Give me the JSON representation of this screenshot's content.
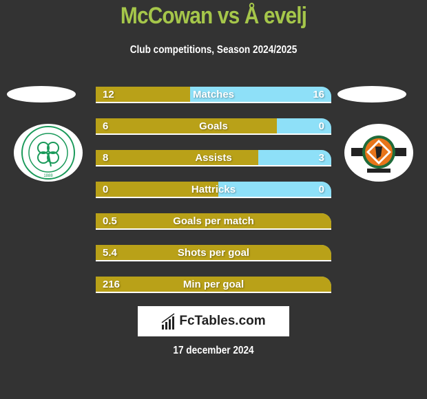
{
  "header": {
    "title": "McCowan vs Å evelj",
    "subtitle": "Club competitions, Season 2024/2025"
  },
  "teams": {
    "left": {
      "crest_icon": "celtic-fc-crest-icon",
      "crest_text": "THE CELTIC FOOTBALL CLUB 1888"
    },
    "right": {
      "crest_icon": "dundee-united-crest-icon"
    }
  },
  "colors": {
    "left_bar": "#b9a118",
    "right_bar": "#8ee0f8",
    "title": "#a5c64a",
    "background": "#333333"
  },
  "stats": [
    {
      "label": "Matches",
      "left": "12",
      "right": "16",
      "left_share": 0.4
    },
    {
      "label": "Goals",
      "left": "6",
      "right": "0",
      "left_share": 0.77
    },
    {
      "label": "Assists",
      "left": "8",
      "right": "3",
      "left_share": 0.69
    },
    {
      "label": "Hattricks",
      "left": "0",
      "right": "0",
      "left_share": 0.52
    },
    {
      "label": "Goals per match",
      "left": "0.5",
      "right": "",
      "left_share": 1.0
    },
    {
      "label": "Shots per goal",
      "left": "5.4",
      "right": "",
      "left_share": 1.0
    },
    {
      "label": "Min per goal",
      "left": "216",
      "right": "",
      "left_share": 1.0
    }
  ],
  "brand": {
    "icon": "bar-chart-icon",
    "text": "FcTables.com"
  },
  "footer": {
    "date": "17 december 2024"
  }
}
